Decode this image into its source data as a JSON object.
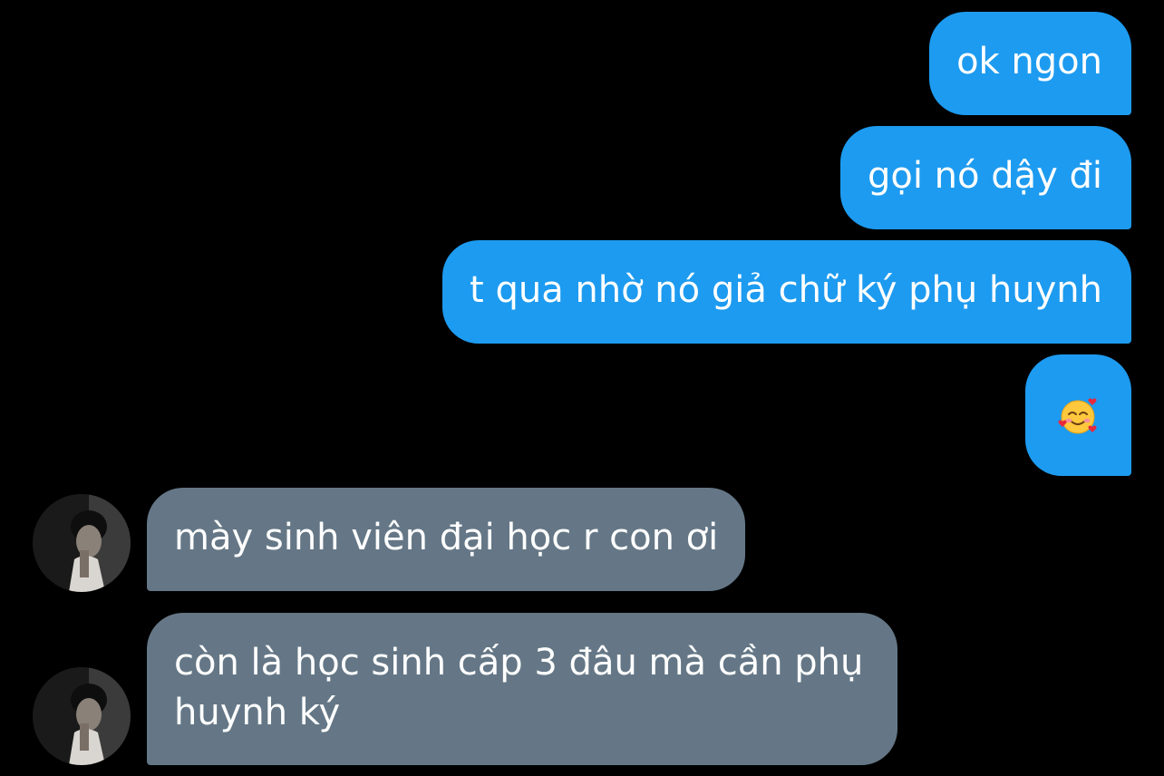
{
  "messages": [
    {
      "direction": "sent",
      "text": "ok ngon"
    },
    {
      "direction": "sent",
      "text": "gọi nó dậy đi"
    },
    {
      "direction": "sent",
      "text": "t qua nhờ nó giả chữ ký phụ huynh"
    },
    {
      "direction": "sent",
      "emoji": "smiling-face-with-hearts-icon"
    },
    {
      "direction": "received",
      "text": "mày sinh viên đại học r con ơi"
    },
    {
      "direction": "received",
      "text": "còn là học sinh cấp 3 đâu mà cần phụ huynh ký"
    }
  ],
  "colors": {
    "background": "#000000",
    "sent_bubble": "#1d9bf0",
    "received_bubble": "#657786",
    "text": "#ffffff"
  }
}
